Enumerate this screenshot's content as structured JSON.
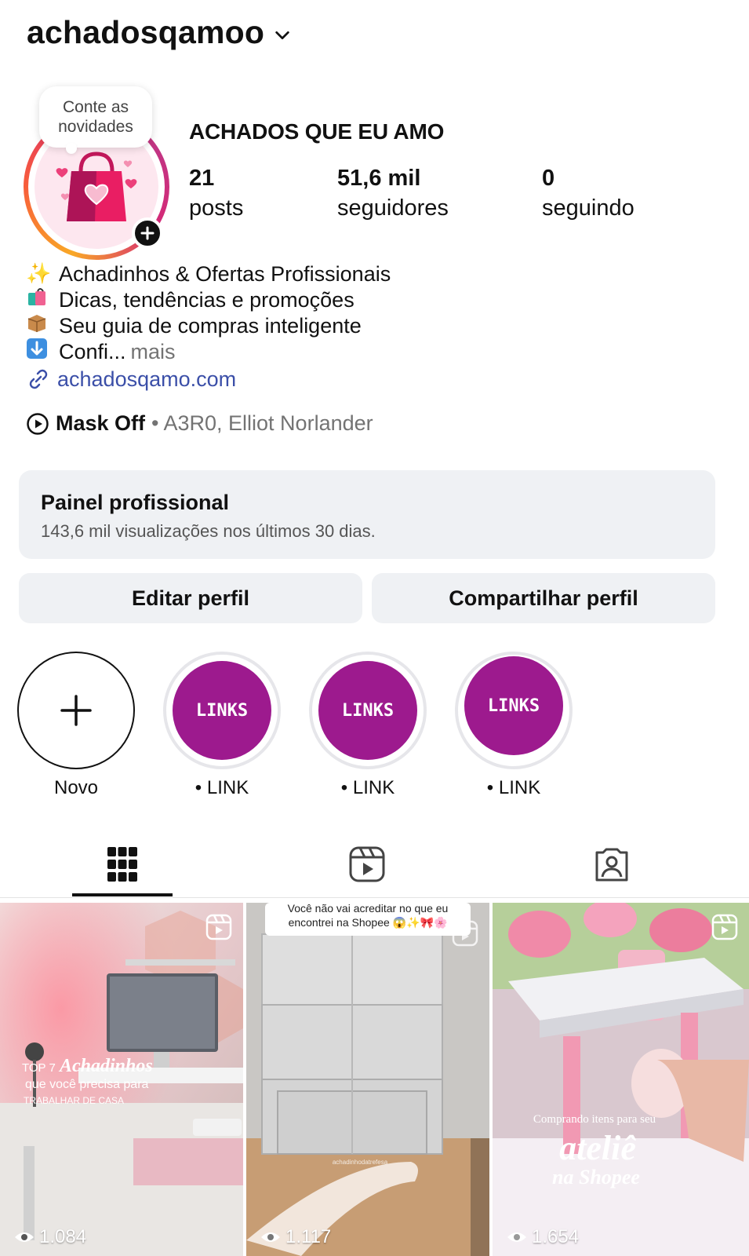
{
  "header": {
    "username": "achadosqamoo"
  },
  "profile": {
    "note": "Conte as novidades",
    "display_name": "ACHADOS QUE EU AMO",
    "stats": [
      {
        "num": "21",
        "label": "posts"
      },
      {
        "num": "51,6 mil",
        "label": "seguidores"
      },
      {
        "num": "0",
        "label": "seguindo"
      }
    ],
    "bio": [
      {
        "emoji": "✨",
        "text": "Achadinhos & Ofertas Profissionais"
      },
      {
        "emoji": "🛍",
        "text": "Dicas, tendências e promoções"
      },
      {
        "emoji": "📦",
        "text": "Seu guia de compras inteligente"
      },
      {
        "emoji": "⬇",
        "text": "Confi...",
        "more": "mais"
      }
    ],
    "link": "achadosqamo.com",
    "music": {
      "song": "Mask Off",
      "artist": "• A3R0, Elliot Norlander"
    }
  },
  "panel": {
    "title": "Painel profissional",
    "subtitle": "143,6 mil visualizações nos últimos 30 dias."
  },
  "buttons": {
    "edit": "Editar perfil",
    "share": "Compartilhar perfil"
  },
  "highlights": [
    {
      "label": "Novo"
    },
    {
      "label": "• LINK",
      "cover_text": "LINKS"
    },
    {
      "label": "• LINK",
      "cover_text": "LINKS"
    },
    {
      "label": "• LINK",
      "cover_text": "LINKS"
    }
  ],
  "posts": [
    {
      "views": "1.084",
      "caption_small": "TOP 7",
      "caption_big": "Achadinhos",
      "caption_line2": "que você precisa para",
      "caption_line3": "TRABALHAR DE CASA"
    },
    {
      "views": "1.117",
      "caption_top1": "Você não vai acreditar no que eu",
      "caption_top2": "encontrei na Shopee 😱✨🎀🌸",
      "watermark": "achadinhodatrefesa"
    },
    {
      "views": "1.654",
      "caption_small": "Comprando itens para seu",
      "caption_big": "ateliê",
      "caption_line2": "na Shopee"
    }
  ],
  "colors": {
    "highlight_purple": "#9d1a8e",
    "panel_bg": "#eff1f4",
    "link": "#3b4fa8"
  }
}
